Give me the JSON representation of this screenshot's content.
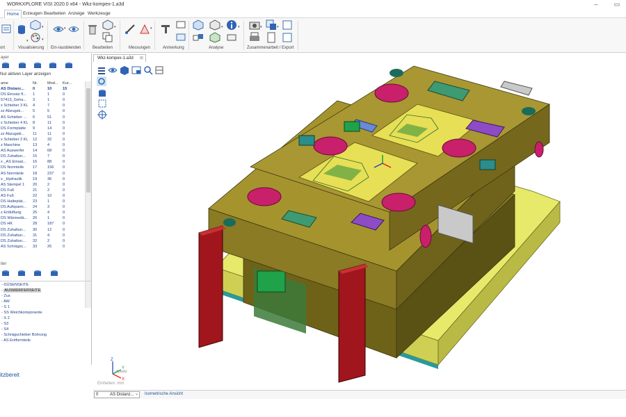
{
  "window": {
    "title": "WORKXPLORE VISI 2020.0 x64 - Wkz-kompex-1.a3d",
    "minimize": "–",
    "maximize": "▭"
  },
  "menu": {
    "items": [
      "Home",
      "Erzeugen",
      "Bearbeiten",
      "Anzeige",
      "Werkzeuge"
    ],
    "active": "Home"
  },
  "ribbon": {
    "groups": [
      "ort",
      "Visualisierung",
      "Ein-/ausblenden",
      "Bearbeiten",
      "Messungen",
      "Anmerkung",
      "Analyse",
      "Zusammenarbeit / Export"
    ]
  },
  "layers_panel": {
    "title": "ayer",
    "checkbox_label": "Nur aktiven Layer anzeigen",
    "columns": [
      "ame",
      "Nr.",
      "Mod...",
      "Kur..."
    ],
    "rows": [
      [
        "AS Distanz...",
        "0",
        "10",
        "15"
      ],
      [
        "DS Einsatz fl...",
        "1",
        "1",
        "0"
      ],
      [
        "57413_Geha...",
        "3",
        "1",
        "0"
      ],
      [
        "x Schieber 3 KL",
        "4",
        "7",
        "0"
      ],
      [
        "zz Abzugsk...",
        "5",
        "5",
        "0"
      ],
      [
        "AS Schieber ...",
        "6",
        "51",
        "0"
      ],
      [
        "x Schieber 4 KL",
        "8",
        "11",
        "0"
      ],
      [
        "DS Formplatte",
        "9",
        "14",
        "0"
      ],
      [
        "zz Abzugskl...",
        "11",
        "11",
        "0"
      ],
      [
        "x Schieber 2 KL",
        "12",
        "32",
        "0"
      ],
      [
        "z Maschine",
        "13",
        "4",
        "0"
      ],
      [
        "AS Auswerfer",
        "14",
        "68",
        "0"
      ],
      [
        "DS Zuhaltun...",
        "15",
        "7",
        "0"
      ],
      [
        "x _AS Einsat...",
        "16",
        "88",
        "0"
      ],
      [
        "DS Normteile",
        "17",
        "156",
        "0"
      ],
      [
        "AS Normteile",
        "18",
        "237",
        "0"
      ],
      [
        "x _Hydraulik",
        "19",
        "36",
        "0"
      ],
      [
        "AS Stempel 1",
        "20",
        "2",
        "0"
      ],
      [
        "DS Fuß",
        "21",
        "2",
        "0"
      ],
      [
        "AS Fuß",
        "22",
        "10",
        "0"
      ],
      [
        "DS Halteplat...",
        "23",
        "1",
        "0"
      ],
      [
        "DS Aufspann...",
        "24",
        "3",
        "0"
      ],
      [
        "z Entlüftung",
        "25",
        "4",
        "0"
      ],
      [
        "DS Wärmedä...",
        "26",
        "1",
        "0"
      ],
      [
        "DS HK",
        "28",
        "187",
        "0"
      ],
      [
        "DS Zuhaltun...",
        "30",
        "12",
        "0"
      ],
      [
        "DS Zuhaltun...",
        "31",
        "4",
        "0"
      ],
      [
        "DS Zuhaltun...",
        "32",
        "2",
        "0"
      ],
      [
        "AS Schrägsc...",
        "33",
        "26",
        "0"
      ]
    ]
  },
  "filter_panel": {
    "title": "iter",
    "tree": [
      "DÜSENSEITE",
      "AUSWERFERSEITE",
      "Zus",
      "AW",
      "S 1",
      "SS Weichkomponente",
      "S 2",
      "S3",
      "S4",
      "Schrägschieber Bohrung",
      "AS Entformteile"
    ],
    "selected": "AUSWERFERSEITE"
  },
  "status": {
    "left": "itzbereit"
  },
  "viewport": {
    "tab_label": "Wkz-kompex-1.a3d",
    "units_label": "Einheiten: mm",
    "axis": {
      "x": "X",
      "y": "Y",
      "z": "Z",
      "origin": "ullpunkt"
    }
  },
  "bottom_bar": {
    "num": "0",
    "layer": "AS Distanz...",
    "view": "Isometrische Ansicht"
  },
  "colors": {
    "accent": "#1b4f9c",
    "plate": "#b7a43a",
    "insert": "#dfe05a",
    "red": "#a0161c",
    "magenta": "#c8206b"
  }
}
